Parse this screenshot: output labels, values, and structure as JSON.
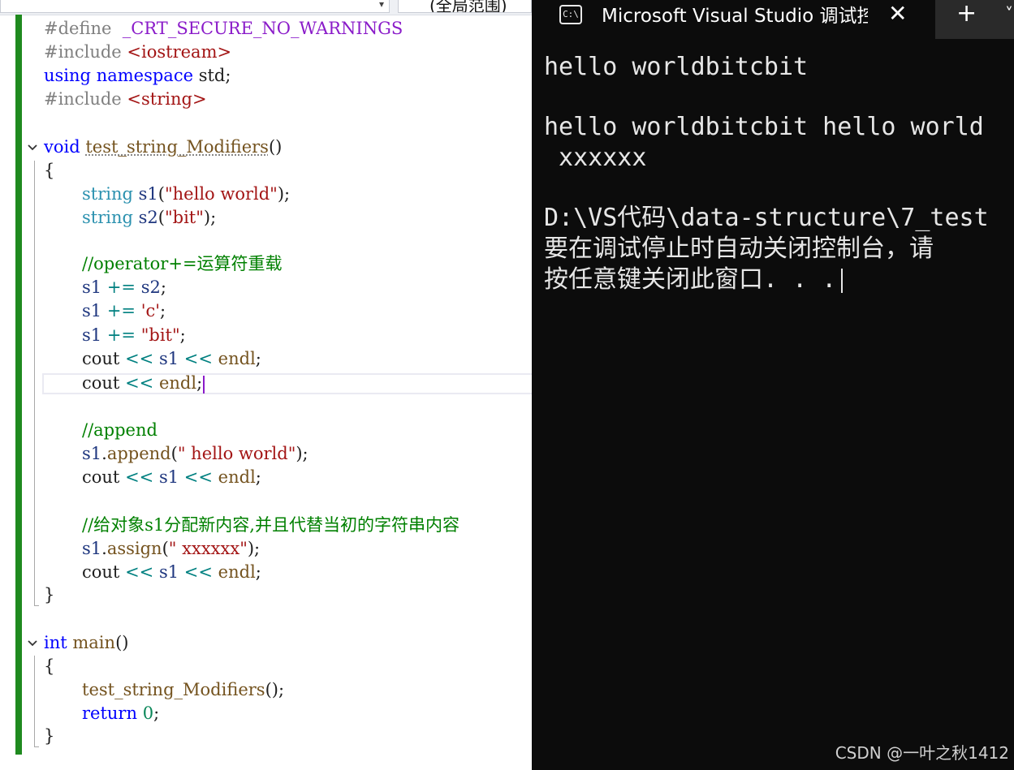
{
  "editor": {
    "top_bar": {
      "scope_label": "(全局范围)"
    },
    "lines": {
      "l1": {
        "pp": "#define",
        "mac": "_CRT_SECURE_NO_WARNINGS"
      },
      "l2": {
        "pp": "#include",
        "inc": "<iostream>"
      },
      "l3": {
        "kw1": "using",
        "kw2": "namespace",
        "rest": "std;"
      },
      "l4": {
        "pp": "#include",
        "inc": "<string>"
      },
      "l5": {
        "kw": "void",
        "fn": "test_string_Modifiers",
        "rest": "()"
      },
      "l6": {
        "text": "{"
      },
      "l7": {
        "ty": "string",
        "var": "s1",
        "p1": "(",
        "str": "\"hello world\"",
        "p2": ");"
      },
      "l8": {
        "ty": "string",
        "var": "s2",
        "p1": "(",
        "str": "\"bit\"",
        "p2": ");"
      },
      "l9": {
        "cm": "//operator+=运算符重载"
      },
      "l10": {
        "v1": "s1",
        "op": "+=",
        "v2": "s2",
        "end": ";"
      },
      "l11": {
        "v1": "s1",
        "op": "+=",
        "str": "'c'",
        "end": ";"
      },
      "l12": {
        "v1": "s1",
        "op": "+=",
        "str": "\"bit\"",
        "end": ";"
      },
      "l13": {
        "a": "cout",
        "op1": "<<",
        "b": "s1",
        "op2": "<<",
        "c": "endl",
        "end": ";"
      },
      "l14": {
        "a": "cout",
        "op1": "<<",
        "c": "endl",
        "end": ";"
      },
      "l15": {
        "cm": "//append"
      },
      "l16": {
        "v": "s1",
        "dot": ".",
        "fn": "append",
        "p1": "(",
        "str": "\" hello world\"",
        "p2": ");"
      },
      "l17": {
        "a": "cout",
        "op1": "<<",
        "b": "s1",
        "op2": "<<",
        "c": "endl",
        "end": ";"
      },
      "l18": {
        "cm": "//给对象s1分配新内容,并且代替当初的字符串内容"
      },
      "l19": {
        "v": "s1",
        "dot": ".",
        "fn": "assign",
        "p1": "(",
        "str": "\" xxxxxx\"",
        "p2": ");"
      },
      "l20": {
        "a": "cout",
        "op1": "<<",
        "b": "s1",
        "op2": "<<",
        "c": "endl",
        "end": ";"
      },
      "l21": {
        "text": "}"
      },
      "l22": {
        "kw": "int",
        "fn": "main",
        "rest": "()"
      },
      "l23": {
        "text": "{"
      },
      "l24": {
        "fn": "test_string_Modifiers",
        "rest": "();"
      },
      "l25": {
        "kw": "return",
        "num": "0",
        "end": ";"
      },
      "l26": {
        "text": "}"
      }
    }
  },
  "terminal": {
    "tab_icon": "C:\\",
    "tab_title": "Microsoft Visual Studio 调试控制台",
    "close_glyph": "✕",
    "new_tab_glyph": "+",
    "dropdown_glyph": "˅",
    "output": [
      "hello worldbitcbit",
      "",
      "hello worldbitcbit hello world",
      " xxxxxx",
      "",
      "D:\\VS代码\\data-structure\\7_test",
      "要在调试停止时自动关闭控制台，请",
      "按任意键关闭此窗口. . ."
    ]
  },
  "watermark": "CSDN @一叶之秋1412",
  "colors": {
    "keyword": "#0000ff",
    "type": "#2b91af",
    "function": "#74531f",
    "string": "#a31515",
    "comment": "#008000",
    "preprocessor": "#808080",
    "macro": "#8a1bc9",
    "change_bar": "#1f8a1f",
    "terminal_bg": "#0c0c0c"
  }
}
